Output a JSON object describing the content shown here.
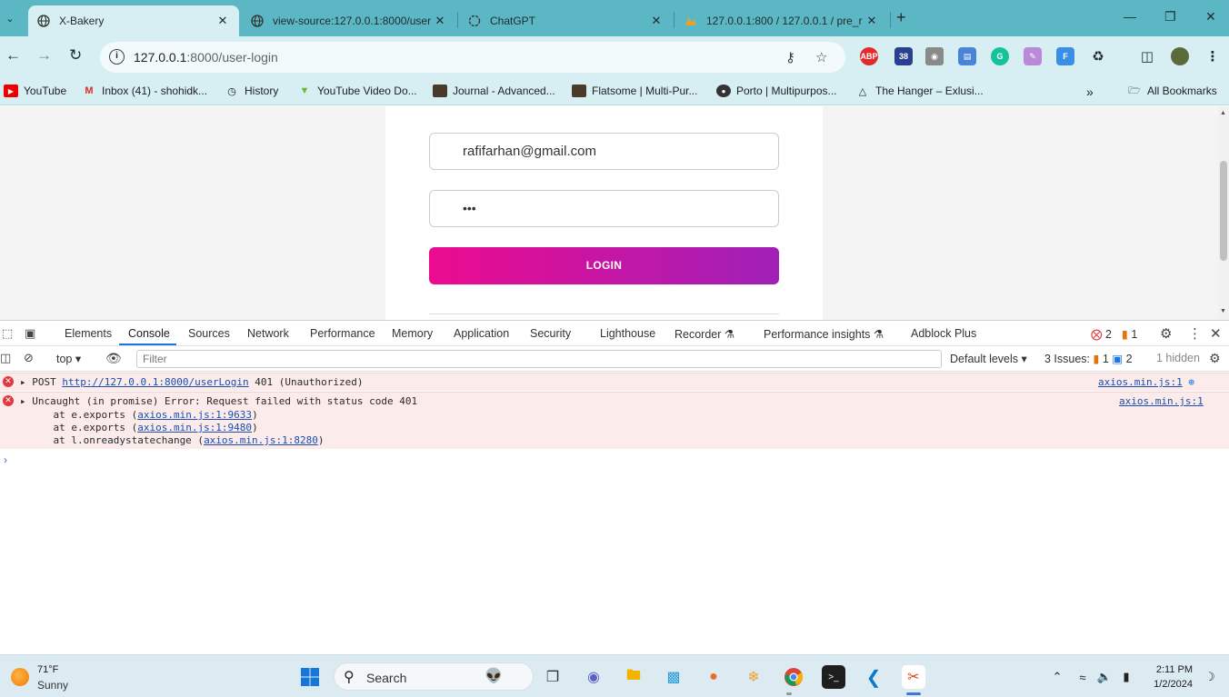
{
  "tabs": [
    {
      "title": "X-Bakery",
      "active": true
    },
    {
      "title": "view-source:127.0.0.1:8000/user",
      "active": false
    },
    {
      "title": "ChatGPT",
      "active": false
    },
    {
      "title": "127.0.0.1:800 / 127.0.0.1 / pre_r",
      "active": false
    }
  ],
  "address": {
    "host": "127.0.0.1",
    "rest": ":8000/user-login"
  },
  "extensions": {
    "abp": "ABP",
    "badge": "38"
  },
  "bookmarks": [
    "YouTube",
    "Inbox (41) - shohidk...",
    "History",
    "YouTube Video Do...",
    "Journal - Advanced...",
    "Flatsome | Multi-Pur...",
    "Porto | Multipurpos...",
    "The Hanger – Exlusi..."
  ],
  "all_bookmarks": "All Bookmarks",
  "form": {
    "email": "rafifarhan@gmail.com",
    "password_mask": "•••",
    "login_label": "LOGIN"
  },
  "devtools": {
    "tabs": [
      "Elements",
      "Console",
      "Sources",
      "Network",
      "Performance",
      "Memory",
      "Application",
      "Security",
      "Lighthouse",
      "Recorder",
      "Performance insights",
      "Adblock Plus"
    ],
    "error_count": "2",
    "warning_count": "1",
    "context": "top",
    "filter_placeholder": "Filter",
    "levels": "Default levels",
    "issues_label": "3 Issues:",
    "issues_warn": "1",
    "issues_info": "2",
    "hidden": "1 hidden",
    "messages": [
      {
        "prefix": "POST ",
        "url": "http://127.0.0.1:8000/userLogin",
        "suffix": " 401 (Unauthorized)",
        "source": "axios.min.js:1"
      },
      {
        "text": "Uncaught (in promise) Error: Request failed with status code 401",
        "stack": [
          {
            "pre": "    at e.exports (",
            "link": "axios.min.js:1:9633",
            "post": ")"
          },
          {
            "pre": "    at e.exports (",
            "link": "axios.min.js:1:9480",
            "post": ")"
          },
          {
            "pre": "    at l.onreadystatechange (",
            "link": "axios.min.js:1:8280",
            "post": ")"
          }
        ],
        "source": "axios.min.js:1"
      }
    ]
  },
  "taskbar": {
    "temp": "71°F",
    "condition": "Sunny",
    "search": "Search",
    "time": "2:11 PM",
    "date": "1/2/2024"
  },
  "colors": {
    "accent_start": "#ec0b8f",
    "accent_end": "#a020b8",
    "error_bg": "#fcebeb",
    "tab_strip": "#5bb7c4"
  }
}
